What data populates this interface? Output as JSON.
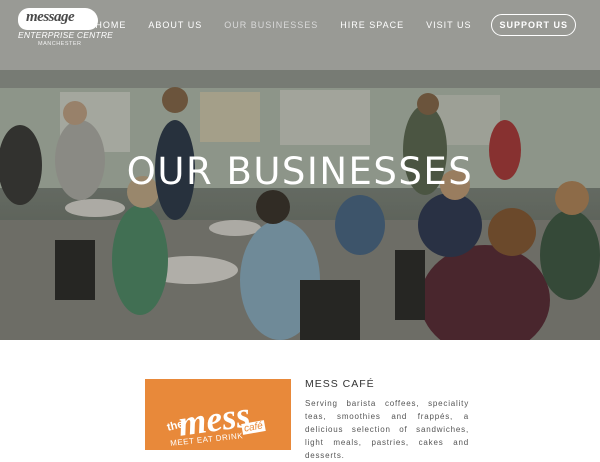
{
  "brand": {
    "logo_word": "message",
    "logo_line2": "ENTERPRISE CENTRE",
    "logo_line3": "MANCHESTER"
  },
  "nav": {
    "items": [
      {
        "label": "HOME"
      },
      {
        "label": "ABOUT US"
      },
      {
        "label": "OUR BUSINESSES"
      },
      {
        "label": "HIRE SPACE"
      },
      {
        "label": "VISIT US"
      }
    ],
    "cta_label": "SUPPORT US"
  },
  "hero": {
    "title": "OUR BUSINESSES"
  },
  "business": {
    "image_text": {
      "the": "the",
      "mess": "mess",
      "cafe": "café",
      "tagline": "MEET EAT DRINK"
    },
    "title": "MESS CAFÉ",
    "description": "Serving barista coffees, speciality teas, smoothies and frappés, a delicious selection of sandwiches, light meals, pastries, cakes and desserts."
  }
}
